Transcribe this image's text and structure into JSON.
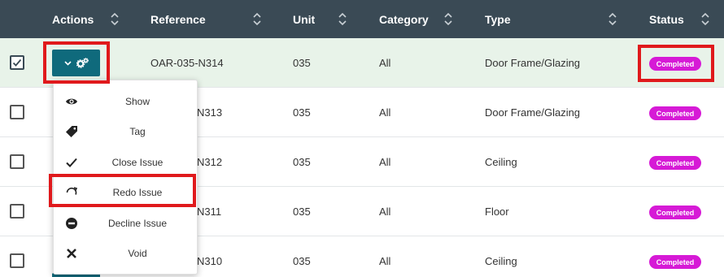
{
  "header": {
    "actions": "Actions",
    "reference": "Reference",
    "unit": "Unit",
    "category": "Category",
    "type": "Type",
    "status": "Status"
  },
  "rows": [
    {
      "reference": "OAR-035-N314",
      "unit": "035",
      "category": "All",
      "type": "Door Frame/Glazing",
      "status": "Completed",
      "checked": true
    },
    {
      "reference": "N313",
      "unit": "035",
      "category": "All",
      "type": "Door Frame/Glazing",
      "status": "Completed",
      "checked": false
    },
    {
      "reference": "N312",
      "unit": "035",
      "category": "All",
      "type": "Ceiling",
      "status": "Completed",
      "checked": false
    },
    {
      "reference": "N311",
      "unit": "035",
      "category": "All",
      "type": "Floor",
      "status": "Completed",
      "checked": false
    },
    {
      "reference": "N310",
      "unit": "035",
      "category": "All",
      "type": "Ceiling",
      "status": "Completed",
      "checked": false
    }
  ],
  "menu": {
    "items": [
      {
        "label": "Show",
        "icon": "eye-icon"
      },
      {
        "label": "Tag",
        "icon": "tag-icon"
      },
      {
        "label": "Close Issue",
        "icon": "check-icon"
      },
      {
        "label": "Redo Issue",
        "icon": "redo-icon"
      },
      {
        "label": "Decline Issue",
        "icon": "minus-circle-icon"
      },
      {
        "label": "Void",
        "icon": "x-icon"
      }
    ]
  },
  "colors": {
    "header_bg": "#3a4a55",
    "selected_row_bg": "#e8f3e9",
    "action_button": "#0f6a7c",
    "status_badge": "#d61ad6",
    "highlight": "#e0191c"
  }
}
